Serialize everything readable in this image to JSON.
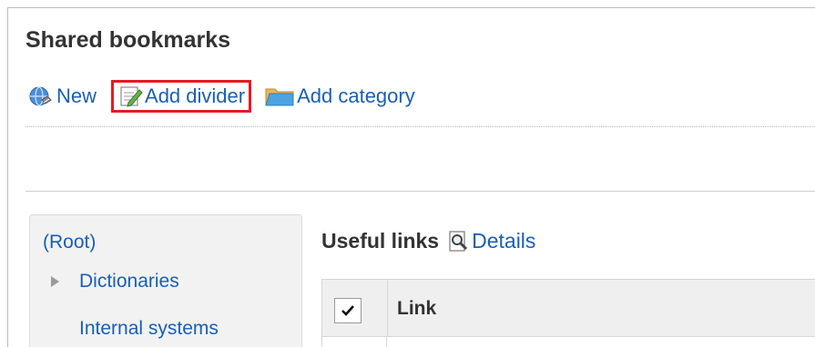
{
  "page_title": "Shared bookmarks",
  "toolbar": {
    "new_label": "New",
    "add_divider_label": "Add divider",
    "add_category_label": "Add category"
  },
  "tree": {
    "root_label": "(Root)",
    "items": [
      "Dictionaries",
      "Internal systems"
    ]
  },
  "category": {
    "name": "Useful links",
    "details_label": "Details"
  },
  "table": {
    "columns": [
      "Link"
    ]
  },
  "colors": {
    "link": "#1a5fb4",
    "highlight": "#e31b23"
  }
}
